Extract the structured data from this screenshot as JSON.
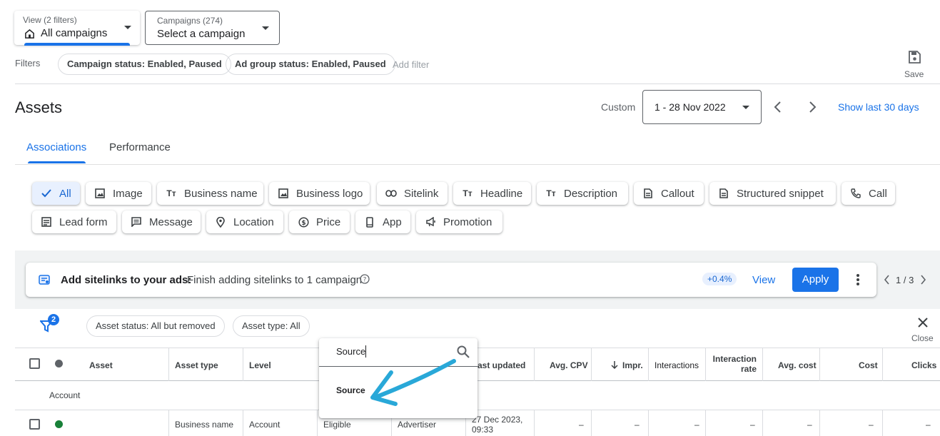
{
  "view_dropdown": {
    "label": "View (2 filters)",
    "value": "All campaigns"
  },
  "campaigns_dropdown": {
    "label": "Campaigns (274)",
    "value": "Select a campaign"
  },
  "filters": {
    "label": "Filters",
    "chips": [
      "Campaign status: Enabled, Paused",
      "Ad group status: Enabled, Paused"
    ],
    "add_label": "Add filter"
  },
  "save_label": "Save",
  "page_title": "Assets",
  "date": {
    "label": "Custom",
    "value": "1 - 28 Nov 2022",
    "show_last": "Show last 30 days"
  },
  "tabs": [
    "Associations",
    "Performance"
  ],
  "asset_chips": [
    {
      "label": "All",
      "icon": "check-icon"
    },
    {
      "label": "Image",
      "icon": "image-icon"
    },
    {
      "label": "Business name",
      "icon": "text-icon"
    },
    {
      "label": "Business logo",
      "icon": "image-icon"
    },
    {
      "label": "Sitelink",
      "icon": "link-icon"
    },
    {
      "label": "Headline",
      "icon": "text-icon"
    },
    {
      "label": "Description",
      "icon": "text-icon"
    },
    {
      "label": "Callout",
      "icon": "document-icon"
    },
    {
      "label": "Structured snippet",
      "icon": "document-icon"
    },
    {
      "label": "Call",
      "icon": "phone-icon"
    },
    {
      "label": "Lead form",
      "icon": "form-icon"
    },
    {
      "label": "Message",
      "icon": "message-icon"
    },
    {
      "label": "Location",
      "icon": "location-pin-icon"
    },
    {
      "label": "Price",
      "icon": "dollar-icon"
    },
    {
      "label": "App",
      "icon": "mobile-icon"
    },
    {
      "label": "Promotion",
      "icon": "megaphone-icon"
    }
  ],
  "recommendation": {
    "title": "Add sitelinks to your ads:",
    "text": "Finish adding sitelinks to 1 campaign",
    "uplift": "+0.4%",
    "view": "View",
    "apply": "Apply",
    "pager": "1 / 3"
  },
  "table_filters": {
    "count": "2",
    "chips": [
      "Asset status: All but removed",
      "Asset type: All"
    ],
    "close_label": "Close"
  },
  "columns": {
    "asset": "Asset",
    "asset_type": "Asset type",
    "level": "Level",
    "last_updated": "ast updated",
    "avg_cpv": "Avg. CPV",
    "impr": "Impr.",
    "interactions": "Interactions",
    "interaction_rate_1": "Interaction",
    "interaction_rate_2": "rate",
    "avg_cost": "Avg. cost",
    "cost": "Cost",
    "clicks": "Clicks"
  },
  "group_row": "Account",
  "rows": [
    {
      "asset_type": "Business name",
      "level": "Account",
      "status": "Eligible",
      "source": "Advertiser",
      "updated_1": "27 Dec 2023,",
      "updated_2": "09:33",
      "avg_cpv": "–",
      "impr": "–",
      "interactions": "–",
      "interaction_rate": "–",
      "avg_cost": "–",
      "cost": "–",
      "clicks": "–"
    }
  ],
  "column_search": {
    "value": "Source",
    "result": "Source"
  },
  "colors": {
    "accent": "#1a73e8",
    "annotation_arrow": "#29a8d8",
    "status_green": "#188038"
  }
}
